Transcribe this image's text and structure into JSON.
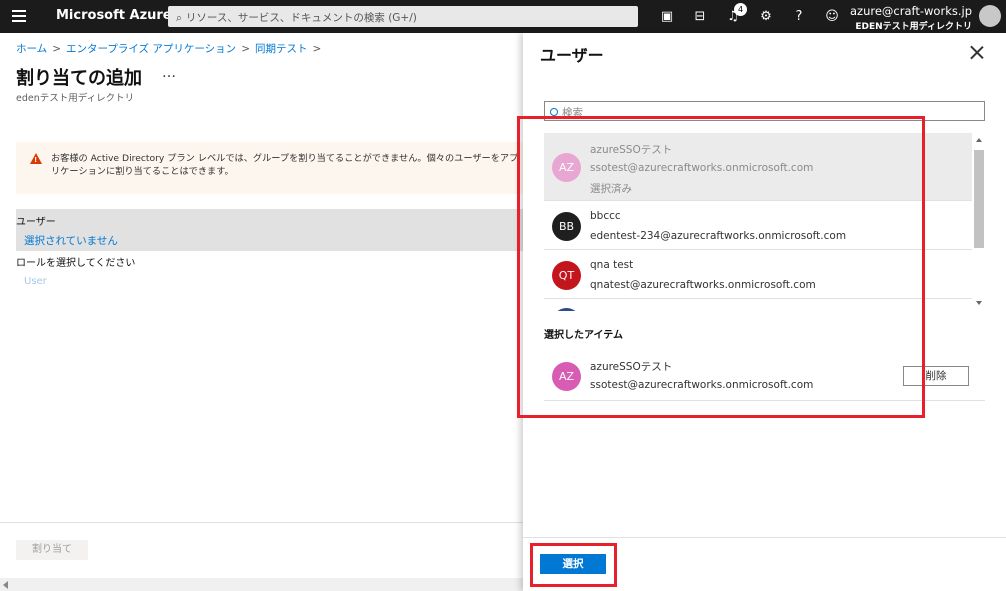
{
  "topbar": {
    "brand": "Microsoft Azure",
    "search_placeholder": "リソース、サービス、ドキュメントの検索 (G+/)",
    "notifications_count": "4",
    "account_email": "azure@craft-works.jp",
    "account_directory": "EDENテスト用ディレクトリ",
    "icons": [
      "cloud-shell-icon",
      "directory-filter-icon",
      "bell-icon",
      "gear-icon",
      "help-icon",
      "feedback-icon"
    ]
  },
  "left": {
    "breadcrumb": [
      "ホーム",
      "エンタープライズ アプリケーション",
      "同期テスト"
    ],
    "title": "割り当ての追加",
    "more": "…",
    "subtitle": "edenテスト用ディレクトリ",
    "warning": "お客様の Active Directory プラン レベルでは、グループを割り当てることができません。個々のユーザーをアプリケーションに割り当てることはできます。",
    "user_label": "ユーザー",
    "user_value": "選択されていません",
    "role_label": "ロールを選択してください",
    "role_value": "User",
    "assign_button": "割り当て"
  },
  "panel": {
    "title": "ユーザー",
    "search_placeholder": "検索",
    "items": [
      {
        "initials": "AZ",
        "name": "azureSSOテスト",
        "email": "ssotest@azurecraftworks.onmicrosoft.com",
        "status": "選択済み",
        "color": "#e8a6d2"
      },
      {
        "initials": "BB",
        "name": "bbccc",
        "email": "edentest-234@azurecraftworks.onmicrosoft.com",
        "color": "#1f1f1f"
      },
      {
        "initials": "QT",
        "name": "qna test",
        "email": "qnatest@azurecraftworks.onmicrosoft.com",
        "color": "#c4141c"
      }
    ],
    "selected_title": "選択したアイテム",
    "selected_item": {
      "initials": "AZ",
      "name": "azureSSOテスト",
      "email": "ssotest@azurecraftworks.onmicrosoft.com",
      "color": "#d85cb4"
    },
    "delete_button": "削除",
    "select_button": "選択"
  },
  "colors": {
    "accent": "#0078d4",
    "highlight": "#e8202b"
  }
}
